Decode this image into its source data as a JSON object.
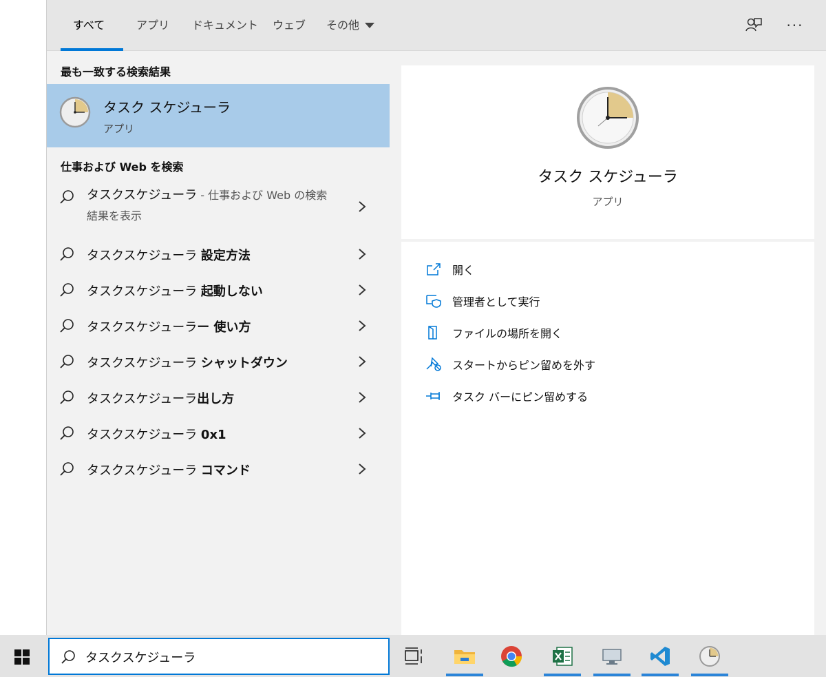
{
  "tabs": [
    {
      "label": "すべて",
      "active": true
    },
    {
      "label": "アプリ"
    },
    {
      "label": "ドキュメント"
    },
    {
      "label": "ウェブ"
    },
    {
      "label": "その他"
    }
  ],
  "header_icons": [
    "feedback-icon",
    "more-options-icon"
  ],
  "header_more": "···",
  "best_match": {
    "section_title": "最も一致する検索結果",
    "title": "タスク スケジューラ",
    "subtitle": "アプリ"
  },
  "web_search": {
    "section_title": "仕事および Web を検索",
    "first": {
      "query": "タスクスケジューラ",
      "suffix": " - 仕事および Web の検索",
      "line2": "結果を表示"
    },
    "suggestions": [
      {
        "prefix": "タスクスケジューラ ",
        "bold": "設定方法"
      },
      {
        "prefix": "タスクスケジューラ ",
        "bold": "起動しない"
      },
      {
        "prefix": "タスクスケジューラ",
        "bold": "ー 使い方"
      },
      {
        "prefix": "タスクスケジューラ ",
        "bold": "シャットダウン"
      },
      {
        "prefix": "タスクスケジューラ",
        "bold": "出し方"
      },
      {
        "prefix": "タスクスケジューラ ",
        "bold": "0x1"
      },
      {
        "prefix": "タスクスケジューラ ",
        "bold": "コマンド"
      }
    ]
  },
  "detail": {
    "title": "タスク スケジューラ",
    "subtitle": "アプリ",
    "actions": [
      {
        "label": "開く",
        "icon": "open-icon"
      },
      {
        "label": "管理者として実行",
        "icon": "admin-shield-icon"
      },
      {
        "label": "ファイルの場所を開く",
        "icon": "file-location-icon"
      },
      {
        "label": "スタートからピン留めを外す",
        "icon": "unpin-start-icon"
      },
      {
        "label": "タスク バーにピン留めする",
        "icon": "pin-taskbar-icon"
      }
    ]
  },
  "taskbar": {
    "search_value": "タスクスケジューラ",
    "apps": [
      "task-view-icon",
      "file-explorer-icon",
      "chrome-icon",
      "excel-icon",
      "remote-desktop-icon",
      "vscode-icon",
      "task-scheduler-icon"
    ]
  },
  "colors": {
    "accent": "#0078d7",
    "selected_bg": "#a8cbe9",
    "panel_bg": "#f2f2f2",
    "header_bg": "#e6e6e6",
    "clock_face_fill": "#e2c98c"
  }
}
